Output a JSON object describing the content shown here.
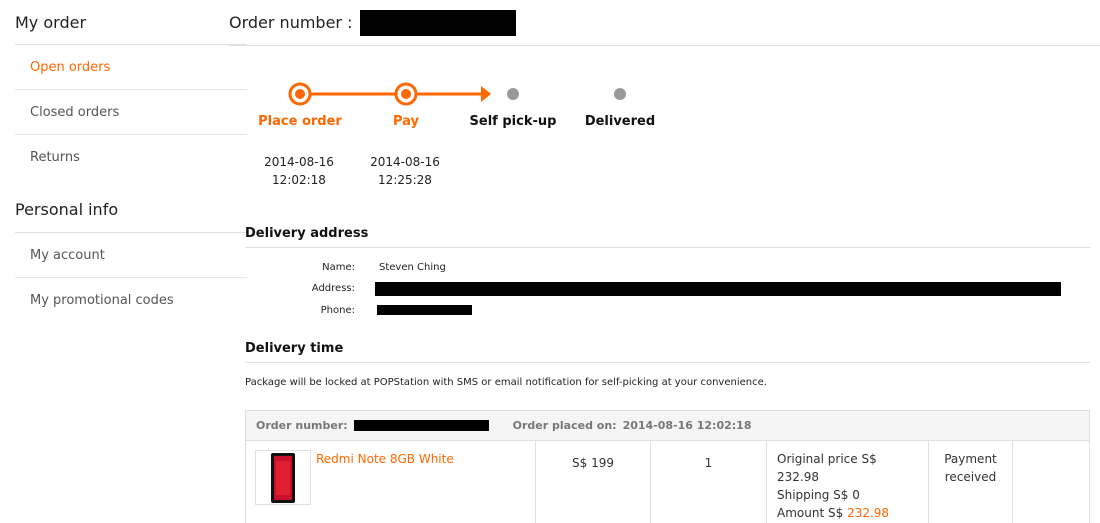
{
  "sidebar": {
    "section1_title": "My order",
    "section1_items": [
      "Open orders",
      "Closed orders",
      "Returns"
    ],
    "section2_title": "Personal info",
    "section2_items": [
      "My account",
      "My promotional codes"
    ]
  },
  "order": {
    "number_label": "Order number :"
  },
  "progress": {
    "steps": [
      {
        "label": "Place order",
        "date": "2014-08-16",
        "time": "12:02:18",
        "done": true
      },
      {
        "label": "Pay",
        "date": "2014-08-16",
        "time": "12:25:28",
        "done": true
      },
      {
        "label": "Self pick-up",
        "done": false
      },
      {
        "label": "Delivered",
        "done": false
      }
    ],
    "accent": "#ff6700",
    "pending_color": "#999999"
  },
  "delivery_address": {
    "title": "Delivery address",
    "name_label": "Name:",
    "name_value": "Steven Ching",
    "address_label": "Address:",
    "phone_label": "Phone:"
  },
  "delivery_time": {
    "title": "Delivery time",
    "note": "Package will be locked at POPStation with SMS or email notification for self-picking at your convenience."
  },
  "order_table": {
    "number_label": "Order number:",
    "placed_label": "Order placed on:",
    "placed_value": "2014-08-16 12:02:18",
    "item": {
      "name": "Redmi Note 8GB White",
      "unit_price": "S$ 199",
      "quantity": "1",
      "original_price_label": "Original price S$",
      "original_price_value": "232.98",
      "shipping": "Shipping S$ 0",
      "amount_label": "Amount S$",
      "amount_value": "232.98",
      "status": "Payment received"
    }
  }
}
